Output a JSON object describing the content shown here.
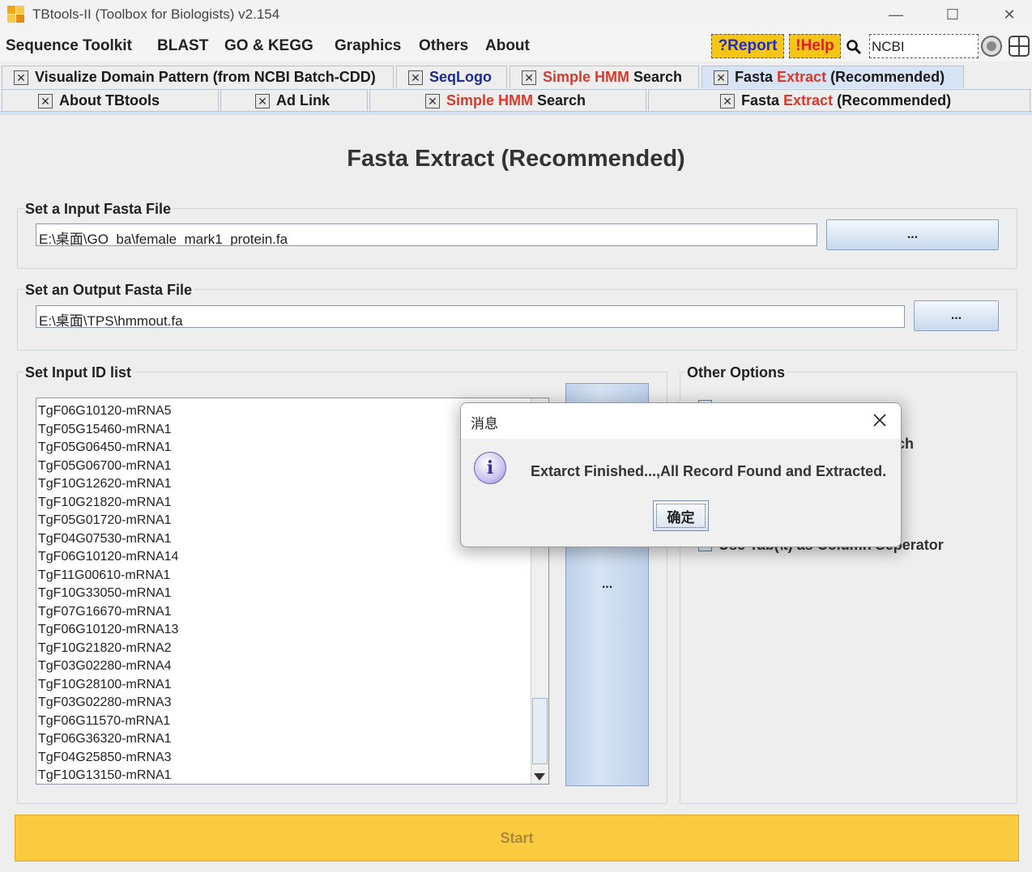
{
  "window": {
    "title": "TBtools-II (Toolbox for Biologists) v2.154",
    "minimize": "—",
    "maximize": "☐",
    "close": "✕"
  },
  "menu": {
    "items": [
      "Sequence Toolkit",
      "BLAST",
      "GO & KEGG",
      "Graphics",
      "Others",
      "About"
    ],
    "report": "?Report",
    "help": "!Help",
    "search_value": "NCBI"
  },
  "tabs_row1": [
    {
      "parts": [
        [
          "Visualize Domain Pattern (from NCBI Batch-CDD)",
          "dark"
        ]
      ]
    },
    {
      "parts": [
        [
          "SeqLogo",
          "blue"
        ]
      ]
    },
    {
      "parts": [
        [
          "Simple HMM",
          "red"
        ],
        [
          " Search",
          "dark"
        ]
      ]
    },
    {
      "parts": [
        [
          "Fasta ",
          "dark"
        ],
        [
          "Extract",
          "red"
        ],
        [
          " (Recommended)",
          "dark"
        ]
      ]
    }
  ],
  "tabs_row2": [
    {
      "parts": [
        [
          "About TBtools",
          "dark"
        ]
      ]
    },
    {
      "parts": [
        [
          "Ad Link",
          "dark"
        ]
      ]
    },
    {
      "parts": [
        [
          "Simple HMM",
          "red"
        ],
        [
          " Search",
          "dark"
        ]
      ]
    },
    {
      "parts": [
        [
          "Fasta ",
          "dark"
        ],
        [
          "Extract",
          "red"
        ],
        [
          " (Recommended)",
          "dark"
        ]
      ]
    }
  ],
  "page": {
    "title": "Fasta Extract (Recommended)",
    "input_label": "Set a Input Fasta File",
    "input_value": "E:\\桌面\\GO_ba\\female_mark1_protein.fa",
    "output_label": "Set an Output Fasta File",
    "output_value": "E:\\桌面\\TPS\\hmmout.fa",
    "browse_label": "...",
    "idlist_label": "Set Input ID list",
    "idlist_button": "...",
    "ids": [
      "TgF06G10120-mRNA5",
      "TgF05G15460-mRNA1",
      "TgF05G06450-mRNA1",
      "TgF05G06700-mRNA1",
      "TgF10G12620-mRNA1",
      "TgF10G21820-mRNA1",
      "TgF05G01720-mRNA1",
      "TgF04G07530-mRNA1",
      "TgF06G10120-mRNA14",
      "TgF11G00610-mRNA1",
      "TgF10G33050-mRNA1",
      "TgF07G16670-mRNA1",
      "TgF06G10120-mRNA13",
      "TgF10G21820-mRNA2",
      "TgF03G02280-mRNA4",
      "TgF10G28100-mRNA1",
      "TgF03G02280-mRNA3",
      "TgF06G11570-mRNA1",
      "TgF06G36320-mRNA1",
      "TgF04G25850-mRNA3",
      "TgF10G13150-mRNA1"
    ],
    "options_label": "Other Options",
    "option_partial": "ch",
    "option_tab": "Use Tab(\\t) as Column Seperator",
    "start": "Start"
  },
  "dialog": {
    "title": "消息",
    "message": "Extarct Finished...,All Record Found and Extracted.",
    "ok": "确定"
  },
  "colors": {
    "accent_yellow": "#fcca3e",
    "tab_active": "#d6e4f5",
    "red_text": "#d93a2b",
    "blue_text": "#1b2a99"
  }
}
